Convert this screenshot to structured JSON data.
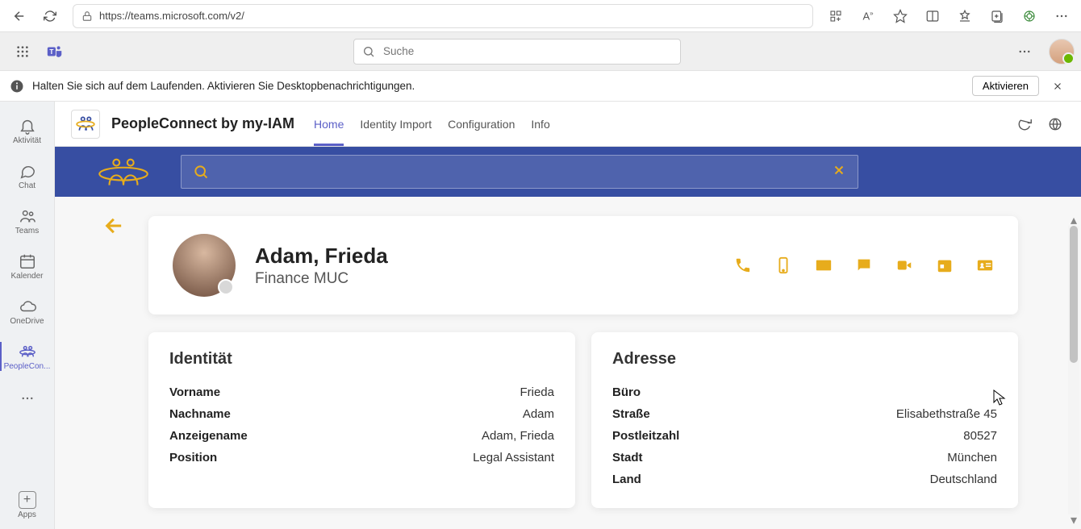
{
  "browser": {
    "url": "https://teams.microsoft.com/v2/"
  },
  "teams": {
    "search_placeholder": "Suche"
  },
  "notify": {
    "text": "Halten Sie sich auf dem Laufenden. Aktivieren Sie Desktopbenachrichtigungen.",
    "button": "Aktivieren"
  },
  "rail": {
    "items": [
      {
        "label": "Aktivität"
      },
      {
        "label": "Chat"
      },
      {
        "label": "Teams"
      },
      {
        "label": "Kalender"
      },
      {
        "label": "OneDrive"
      },
      {
        "label": "PeopleCon..."
      }
    ],
    "apps": "Apps"
  },
  "app": {
    "title": "PeopleConnect by my-IAM",
    "tabs": [
      {
        "label": "Home"
      },
      {
        "label": "Identity Import"
      },
      {
        "label": "Configuration"
      },
      {
        "label": "Info"
      }
    ]
  },
  "profile": {
    "name": "Adam, Frieda",
    "subtitle": "Finance MUC"
  },
  "identity": {
    "title": "Identität",
    "rows": [
      {
        "k": "Vorname",
        "v": "Frieda"
      },
      {
        "k": "Nachname",
        "v": "Adam"
      },
      {
        "k": "Anzeigename",
        "v": "Adam, Frieda"
      },
      {
        "k": "Position",
        "v": "Legal Assistant"
      }
    ]
  },
  "address": {
    "title": "Adresse",
    "rows": [
      {
        "k": "Büro",
        "v": ""
      },
      {
        "k": "Straße",
        "v": "Elisabethstraße 45"
      },
      {
        "k": "Postleitzahl",
        "v": "80527"
      },
      {
        "k": "Stadt",
        "v": "München"
      },
      {
        "k": "Land",
        "v": "Deutschland"
      }
    ]
  }
}
